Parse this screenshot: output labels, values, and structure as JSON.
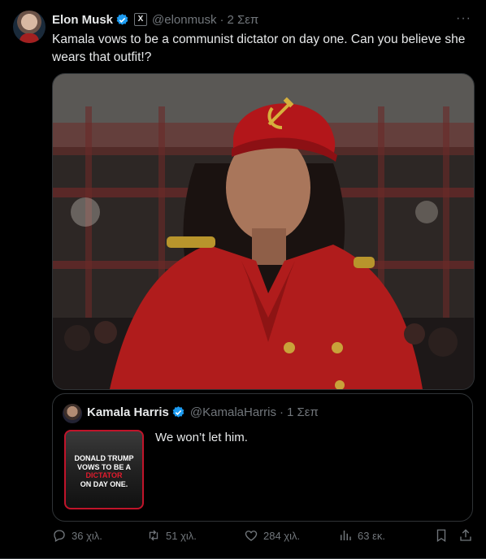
{
  "post": {
    "author_name": "Elon Musk",
    "author_handle": "@elonmusk",
    "separator": "·",
    "time": "2 Σεπ",
    "more": "···",
    "text": "Kamala vows to be a communist dictator on day one. Can you believe she wears that outfit!?"
  },
  "quoted": {
    "author_name": "Kamala Harris",
    "author_handle": "@KamalaHarris",
    "separator": "·",
    "time": "1 Σεπ",
    "text": "We won’t let him.",
    "thumb_lines": [
      "DONALD TRUMP",
      "VOWS TO BE A",
      "DICTATOR",
      "ON DAY ONE."
    ]
  },
  "actions": {
    "replies": "36 χιλ.",
    "reposts": "51 χιλ.",
    "likes": "284 χιλ.",
    "views": "63 εκ."
  },
  "colors": {
    "background": "#000000",
    "text": "#e7e9ea",
    "muted": "#71767b",
    "border": "#2f3336",
    "verified": "#1d9bf0"
  }
}
